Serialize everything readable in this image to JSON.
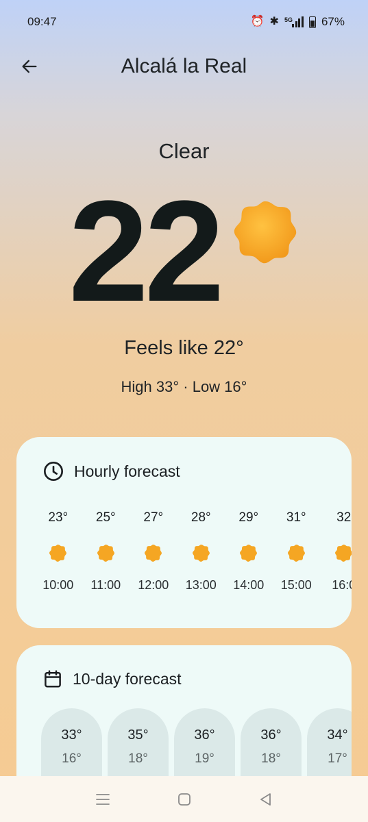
{
  "status": {
    "time": "09:47",
    "network": "5G",
    "battery": "67%"
  },
  "header": {
    "city": "Alcalá la Real"
  },
  "current": {
    "condition": "Clear",
    "temperature": "22",
    "feels_like": "Feels like 22°",
    "high_low": "High 33° · Low 16°"
  },
  "hourly": {
    "title": "Hourly forecast",
    "items": [
      {
        "temp": "23°",
        "time": "10:00"
      },
      {
        "temp": "25°",
        "time": "11:00"
      },
      {
        "temp": "27°",
        "time": "12:00"
      },
      {
        "temp": "28°",
        "time": "13:00"
      },
      {
        "temp": "29°",
        "time": "14:00"
      },
      {
        "temp": "31°",
        "time": "15:00"
      },
      {
        "temp": "32",
        "time": "16:0"
      }
    ]
  },
  "daily": {
    "title": "10-day forecast",
    "items": [
      {
        "high": "33°",
        "low": "16°"
      },
      {
        "high": "35°",
        "low": "18°"
      },
      {
        "high": "36°",
        "low": "19°"
      },
      {
        "high": "36°",
        "low": "18°"
      },
      {
        "high": "34°",
        "low": "17°"
      }
    ]
  },
  "colors": {
    "sun": "#f5a623",
    "card": "#eefaf8",
    "pill": "#dbe9e8"
  },
  "icons": {
    "back": "arrow-left-icon",
    "clock": "clock-icon",
    "calendar": "calendar-icon",
    "sun": "sun-icon"
  }
}
